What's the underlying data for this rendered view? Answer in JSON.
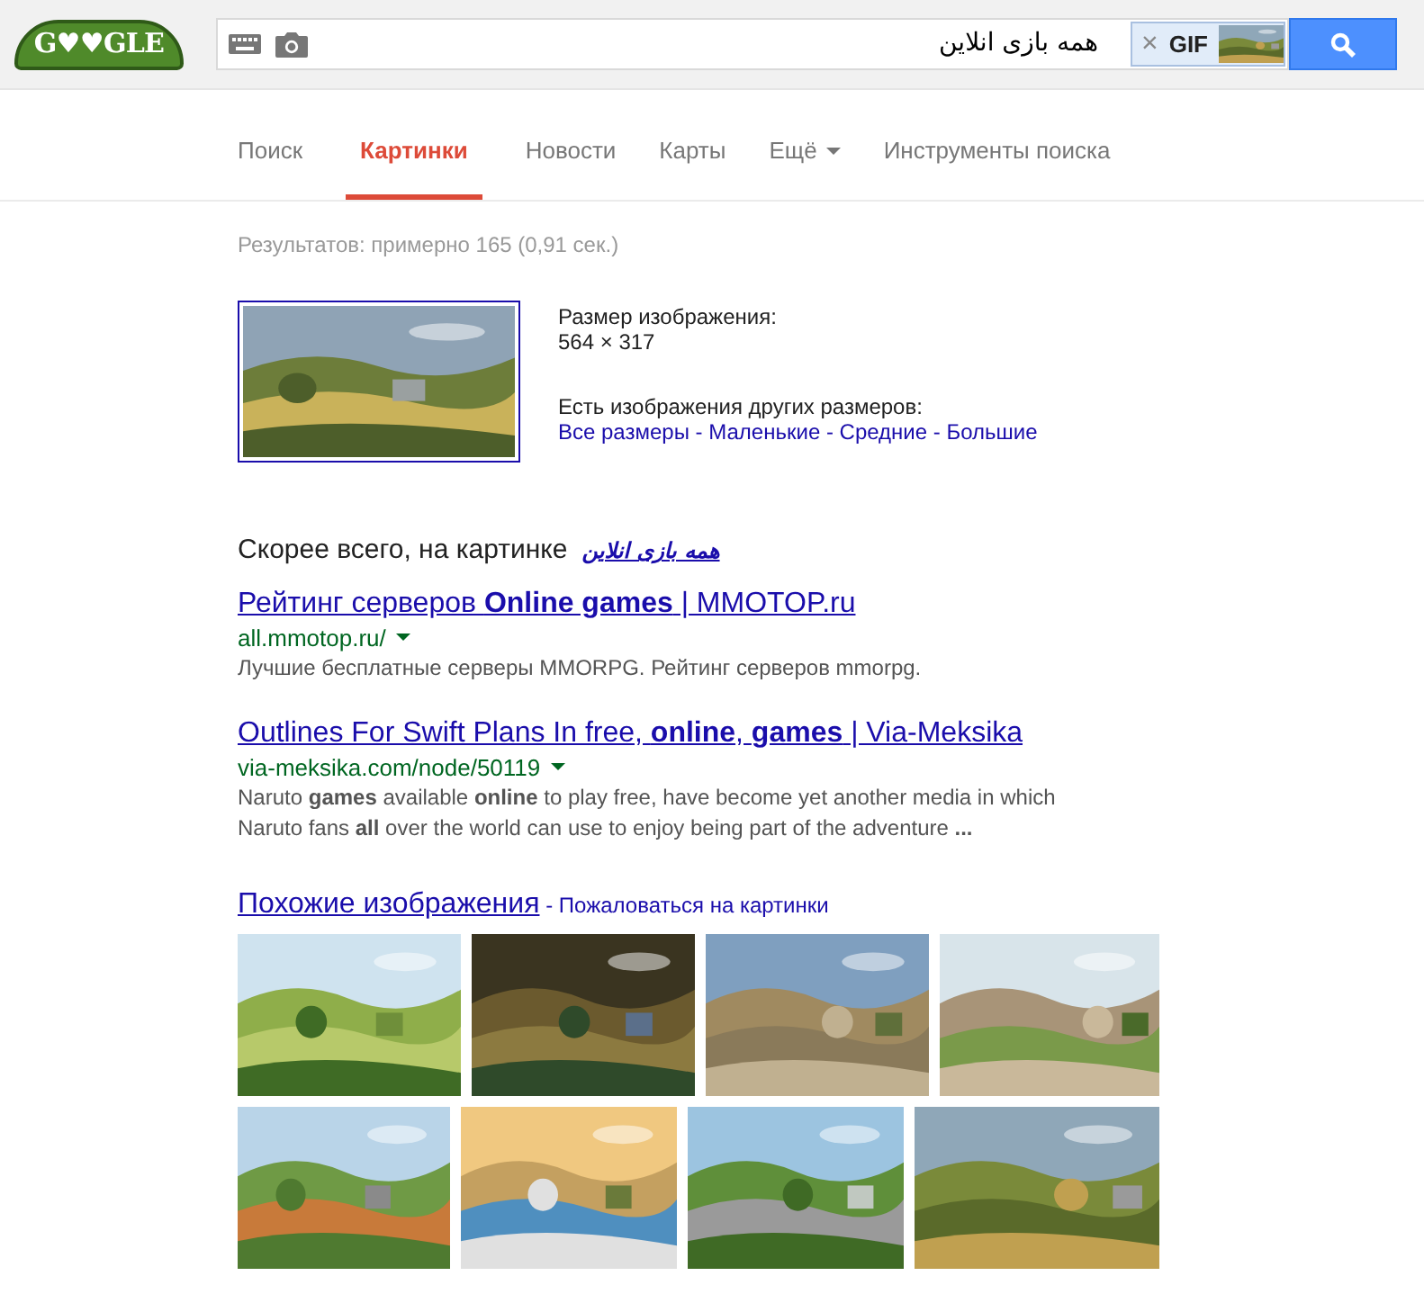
{
  "header": {
    "logo": "G♥♥GLE",
    "search": {
      "value": "همه بازی انلاین",
      "chip": {
        "close": "×",
        "label": "GIF"
      }
    }
  },
  "tabs": [
    {
      "label": "Поиск",
      "selected": false,
      "dropdown": false
    },
    {
      "label": "Картинки",
      "selected": true,
      "dropdown": false
    },
    {
      "label": "Новости",
      "selected": false,
      "dropdown": false
    },
    {
      "label": "Карты",
      "selected": false,
      "dropdown": false
    },
    {
      "label": "Ещё",
      "selected": false,
      "dropdown": true
    },
    {
      "label": "Инструменты поиска",
      "selected": false,
      "dropdown": false
    }
  ],
  "result_stats": "Результатов: примерно 165 (0,91 сек.)",
  "image_info": {
    "size_label": "Размер изображения:",
    "size": "564 × 317",
    "other_sizes_label": "Есть изображения других размеров:",
    "size_links": [
      "Все размеры",
      "Маленькие",
      "Средние",
      "Большие"
    ],
    "separator": " - "
  },
  "best_guess": {
    "label": "Скорее всего, на картинке",
    "query": "همه بازی انلاین"
  },
  "results": [
    {
      "title": "Рейтинг серверов **Online games** | MMOTOP.ru",
      "url": "all.mmotop.ru/",
      "snippet": "Лучшие бесплатные серверы MMORPG. Рейтинг серверов mmorpg."
    },
    {
      "title": "Outlines For Swift Plans In free, **online**, **games** | Via-Meksika",
      "url": "via-meksika.com/node/50119",
      "snippet": "Naruto **games** available **online** to play free, have become yet another media in which Naruto fans **all** over the world can use to enjoy being part of the adventure **...**"
    }
  ],
  "similar": {
    "title": "Похожие изображения",
    "separator": " - ",
    "report": "Пожаловаться на картинки"
  }
}
